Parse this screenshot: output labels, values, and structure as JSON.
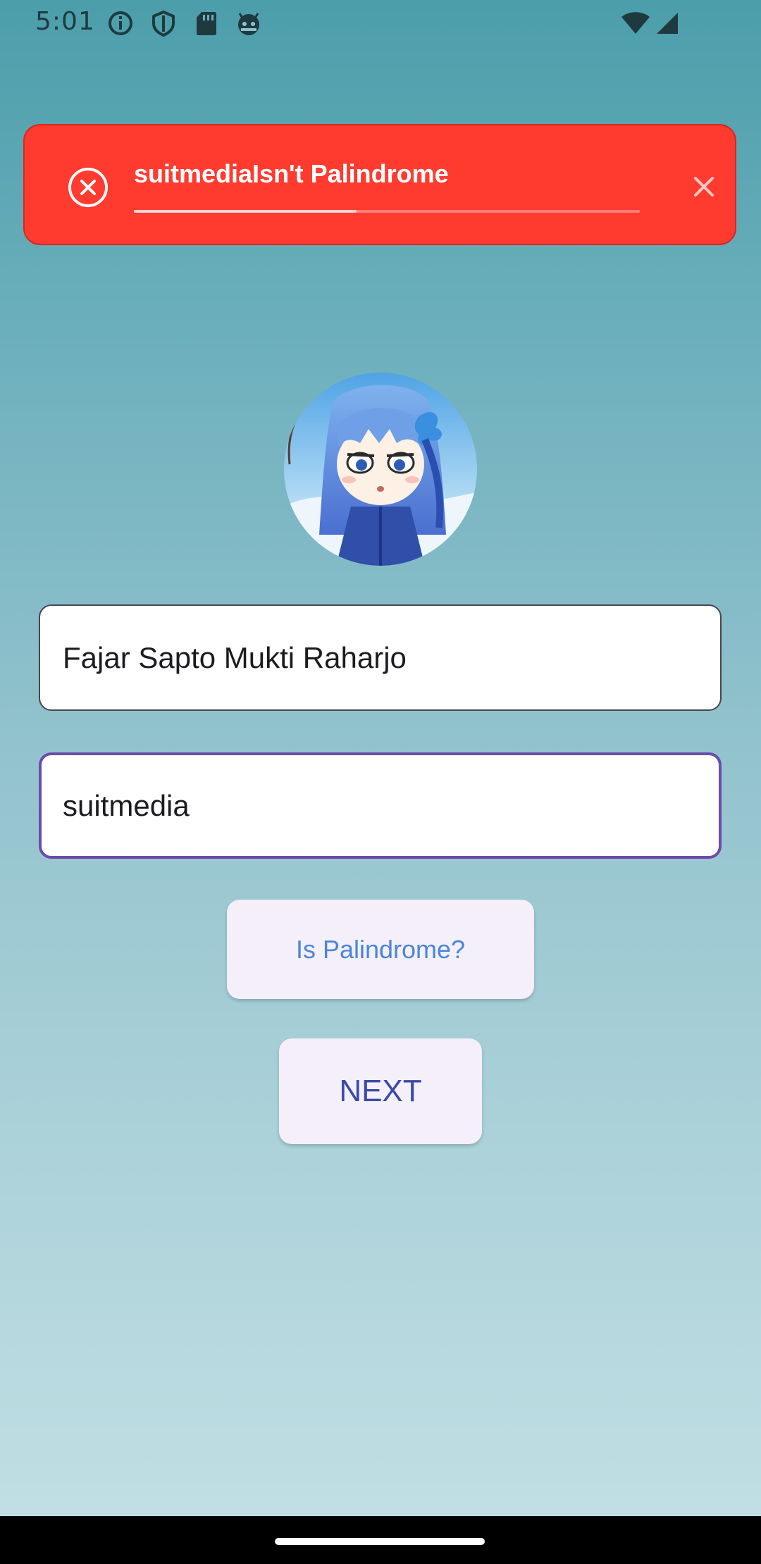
{
  "status_bar": {
    "time": "5:01",
    "icons": [
      "info-icon",
      "shield-icon",
      "sd-card-icon",
      "android-face-icon",
      "wifi-icon",
      "cell-signal-icon"
    ]
  },
  "toast": {
    "message": "suitmediaIsn't Palindrome",
    "progress": 0.44,
    "color": "#ff3b30",
    "icons": [
      "error-circle-icon",
      "close-icon"
    ]
  },
  "avatar": {
    "icon": "avatar-anime-girl"
  },
  "form": {
    "name_value": "Fajar Sapto Mukti Raharjo",
    "sentence_value": "suitmedia",
    "focus_color": "#6c4cab"
  },
  "buttons": {
    "check_label": "Is Palindrome?",
    "next_label": "NEXT"
  },
  "colors": {
    "background_top": "#4c9eab",
    "background_bottom": "#c3e0e5",
    "button_bg": "#f4eff8",
    "check_text": "#4a86d9",
    "next_text": "#3b4aa8"
  }
}
